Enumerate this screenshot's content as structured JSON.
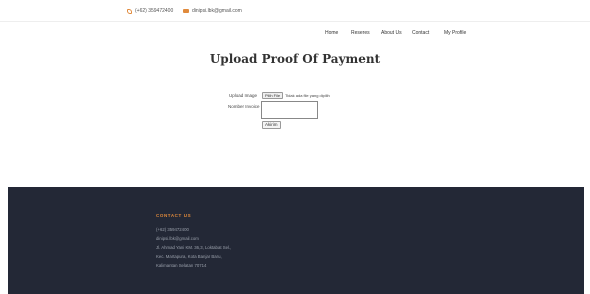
{
  "topbar": {
    "phone": "(+62) 359472400",
    "email": "dinipsi.lbk@gmail.com"
  },
  "nav": {
    "items": [
      "Home",
      "Reseres",
      "About Us",
      "Contact",
      "My Profile"
    ]
  },
  "page": {
    "title": "Upload Proof Of Payment"
  },
  "form": {
    "upload_label": "Upload Image",
    "file_button": "Pilih File",
    "file_status": "Tidak ada file yang dipilih",
    "invoice_label": "Nomber Invoice",
    "invoice_value": "",
    "submit_label": "Akirim"
  },
  "footer": {
    "heading": "CONTACT US",
    "lines": [
      "(+62) 359472400",
      "dinipsi.lbk@gmail.com",
      "Jl. Ahmad Yani KM. 36,3, Loktabat Sel.,",
      "Kec. Martapura, Kota Banjar Baru,",
      "Kalimantan Selatan 70714"
    ]
  }
}
